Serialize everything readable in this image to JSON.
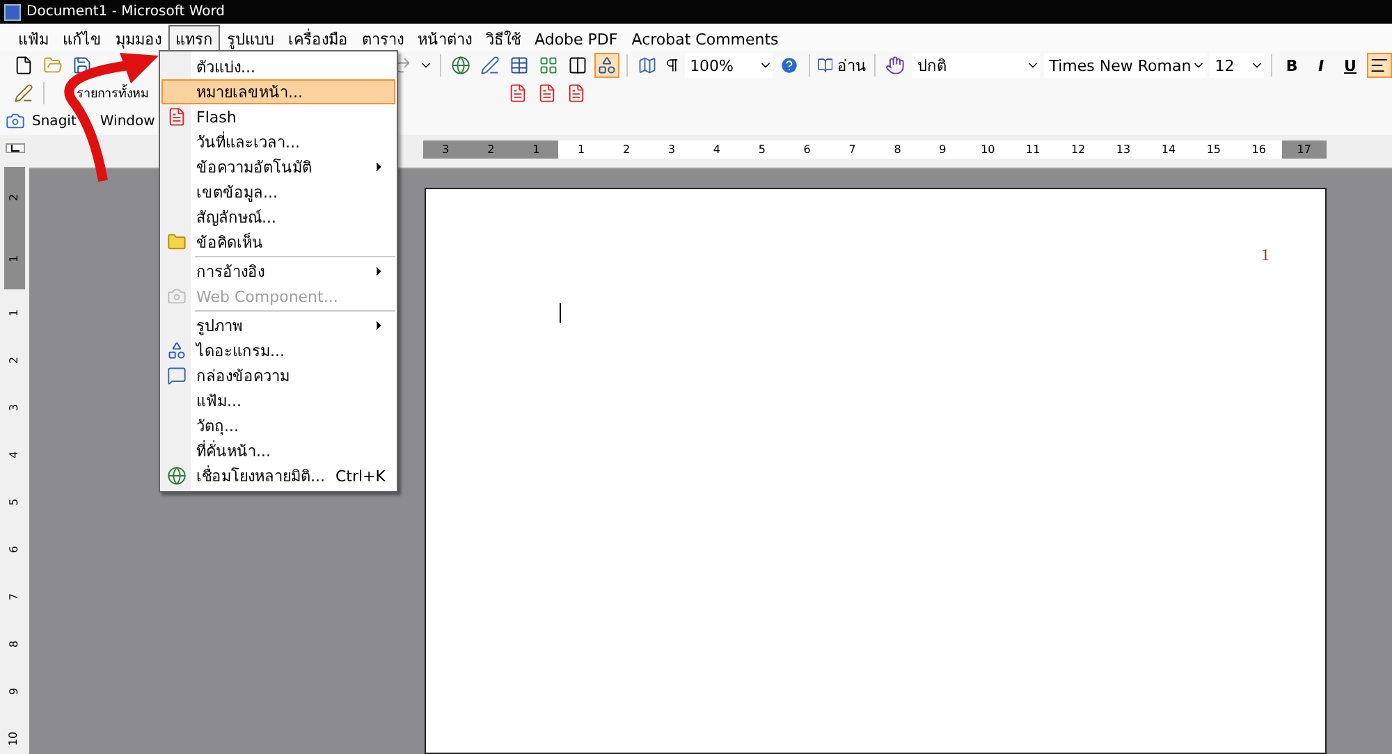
{
  "window": {
    "title": "Document1 - Microsoft Word"
  },
  "menu_bar": [
    {
      "label": "แฟ้ม",
      "selected": false
    },
    {
      "label": "แก้ไข",
      "selected": false
    },
    {
      "label": "มุมมอง",
      "selected": false
    },
    {
      "label": "แทรก",
      "selected": true
    },
    {
      "label": "รูปแบบ",
      "selected": false
    },
    {
      "label": "เครื่องมือ",
      "selected": false
    },
    {
      "label": "ตาราง",
      "selected": false
    },
    {
      "label": "หน้าต่าง",
      "selected": false
    },
    {
      "label": "วิธีใช้",
      "selected": false
    },
    {
      "label": "Adobe PDF",
      "selected": false
    },
    {
      "label": "Acrobat Comments",
      "selected": false
    }
  ],
  "standard_toolbar": {
    "drawing_pressed": true,
    "zoom": "100%",
    "read_button": "อ่าน"
  },
  "formatting_toolbar": {
    "style": "ปกติ",
    "font": "Times New Roman",
    "size": "12",
    "bold": "B",
    "italic": "I",
    "underline": "U",
    "align_left_pressed": true
  },
  "toolbar_2": {
    "list_label": "รายการทั้งหม"
  },
  "toolbar_3": {
    "snagit": "Snagit",
    "window": "Window"
  },
  "insert_menu": [
    {
      "label": "ตัวแบ่ง...",
      "kind": "plain",
      "submenu": false,
      "disabled": false,
      "selected": false
    },
    {
      "label": "หมายเลขหน้า...",
      "kind": "plain",
      "submenu": false,
      "disabled": false,
      "selected": true
    },
    {
      "label": "Flash",
      "kind": "flash",
      "submenu": false,
      "disabled": false,
      "selected": false
    },
    {
      "label": "วันที่และเวลา...",
      "kind": "plain",
      "submenu": false,
      "disabled": false,
      "selected": false
    },
    {
      "label": "ข้อความอัตโนมัติ",
      "kind": "plain",
      "submenu": true,
      "disabled": false,
      "selected": false
    },
    {
      "label": "เขตข้อมูล...",
      "kind": "plain",
      "submenu": false,
      "disabled": false,
      "selected": false
    },
    {
      "label": "สัญลักษณ์...",
      "kind": "plain",
      "submenu": false,
      "disabled": false,
      "selected": false
    },
    {
      "label": "ข้อคิดเห็น",
      "kind": "folder",
      "submenu": false,
      "disabled": false,
      "selected": false,
      "separator_after": true
    },
    {
      "label": "การอ้างอิง",
      "kind": "plain",
      "submenu": true,
      "disabled": false,
      "selected": false
    },
    {
      "label": "Web Component...",
      "kind": "web",
      "submenu": false,
      "disabled": true,
      "selected": false,
      "separator_after": true
    },
    {
      "label": "รูปภาพ",
      "kind": "plain",
      "submenu": true,
      "disabled": false,
      "selected": false
    },
    {
      "label": "ไดอะแกรม...",
      "kind": "diagram",
      "submenu": false,
      "disabled": false,
      "selected": false
    },
    {
      "label": "กล่องข้อความ",
      "kind": "textbox",
      "submenu": false,
      "disabled": false,
      "selected": false
    },
    {
      "label": "แฟ้ม...",
      "kind": "plain",
      "submenu": false,
      "disabled": false,
      "selected": false
    },
    {
      "label": "วัตถุ...",
      "kind": "plain",
      "submenu": false,
      "disabled": false,
      "selected": false
    },
    {
      "label": "ที่คั่นหน้า...",
      "kind": "plain",
      "submenu": false,
      "disabled": false,
      "selected": false
    },
    {
      "label": "เชื่อมโยงหลายมิติ...",
      "kind": "globe",
      "submenu": false,
      "disabled": false,
      "selected": false,
      "shortcut": "Ctrl+K"
    }
  ],
  "horizontal_ruler": [
    "3",
    "2",
    "1",
    "1",
    "2",
    "3",
    "4",
    "5",
    "6",
    "7",
    "8",
    "9",
    "10",
    "11",
    "12",
    "13",
    "14",
    "15",
    "16",
    "17"
  ],
  "vertical_ruler": [
    "2",
    "1",
    "1",
    "2",
    "3",
    "4",
    "5",
    "6",
    "7",
    "8",
    "9",
    "10"
  ],
  "document": {
    "page_number": "1"
  }
}
